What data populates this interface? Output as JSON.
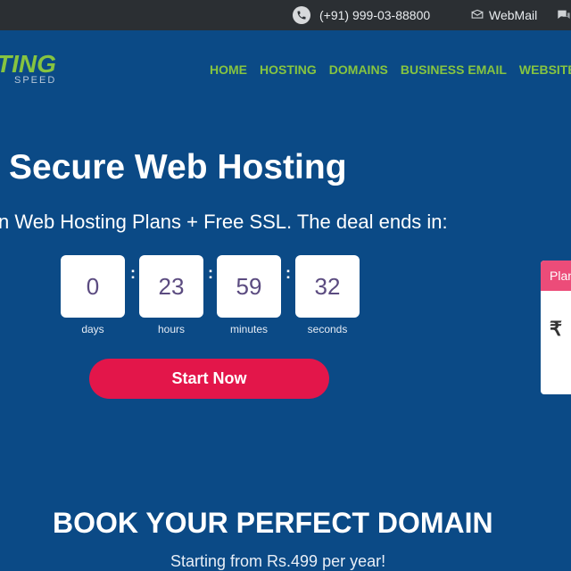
{
  "topbar": {
    "phone_icon": "phone-icon",
    "phone": "(+91) 999-03-88800",
    "mail_icon": "mail-icon",
    "webmail": "WebMail",
    "chat_icon": "chat-icon"
  },
  "logo": {
    "main": "TING",
    "sub": "SPEED"
  },
  "nav": {
    "items": [
      "HOME",
      "HOSTING",
      "DOMAINS",
      "BUSINESS EMAIL",
      "WEBSITE"
    ]
  },
  "hero": {
    "title": "Secure Web Hosting",
    "subtitle": "n Web Hosting Plans + Free SSL. The deal ends in:"
  },
  "countdown": {
    "days": "0",
    "days_label": "days",
    "hours": "23",
    "hours_label": "hours",
    "minutes": "59",
    "minutes_label": "minutes",
    "seconds": "32",
    "seconds_label": "seconds",
    "separator": ":"
  },
  "cta": {
    "label": "Start Now"
  },
  "plan_card": {
    "header": "Plan",
    "currency": "₹"
  },
  "domain": {
    "title": "BOOK YOUR PERFECT DOMAIN",
    "subtitle": "Starting from Rs.499 per year!"
  },
  "colors": {
    "background": "#0b4a86",
    "topbar": "#2b2f33",
    "nav": "#86c440",
    "cta": "#e3164a",
    "plan_header": "#ec4c79"
  }
}
